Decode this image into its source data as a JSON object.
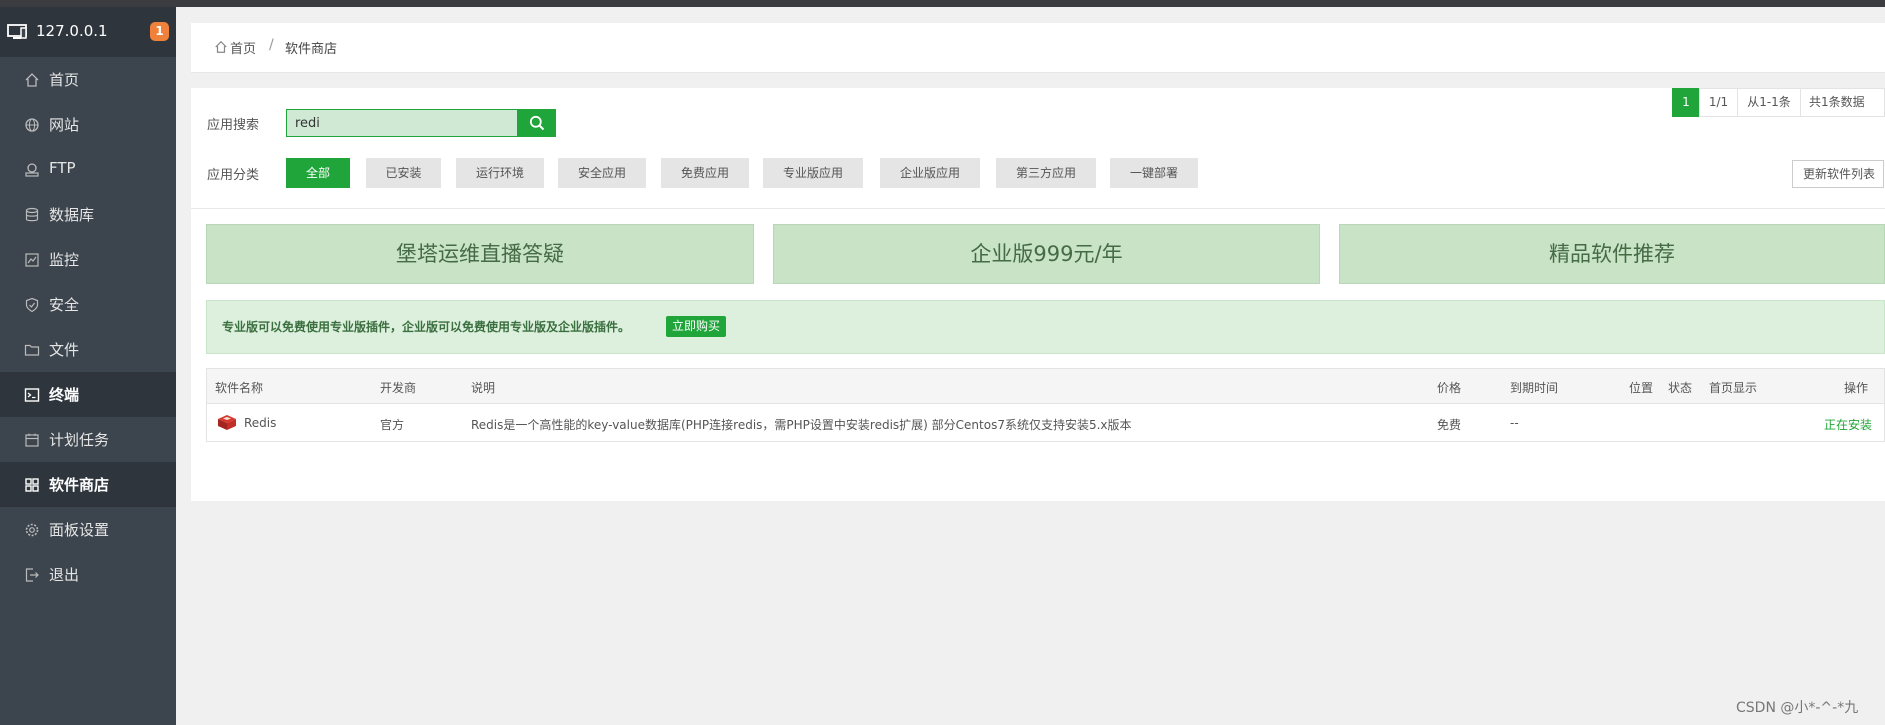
{
  "sidebar": {
    "host": "127.0.0.1",
    "badge": "1",
    "items": [
      {
        "label": "首页",
        "icon": "home-icon"
      },
      {
        "label": "网站",
        "icon": "globe-icon"
      },
      {
        "label": "FTP",
        "icon": "ftp-icon"
      },
      {
        "label": "数据库",
        "icon": "database-icon"
      },
      {
        "label": "监控",
        "icon": "monitor-chart-icon"
      },
      {
        "label": "安全",
        "icon": "shield-icon"
      },
      {
        "label": "文件",
        "icon": "folder-icon"
      },
      {
        "label": "终端",
        "icon": "terminal-icon"
      },
      {
        "label": "计划任务",
        "icon": "calendar-icon"
      },
      {
        "label": "软件商店",
        "icon": "grid-icon"
      },
      {
        "label": "面板设置",
        "icon": "gear-icon"
      },
      {
        "label": "退出",
        "icon": "logout-icon"
      }
    ]
  },
  "breadcrumb": {
    "home": "首页",
    "separator": "/",
    "current": "软件商店"
  },
  "search": {
    "label": "应用搜索",
    "value": "redi"
  },
  "categories": {
    "label": "应用分类",
    "items": [
      "全部",
      "已安装",
      "运行环境",
      "安全应用",
      "免费应用",
      "专业版应用",
      "企业版应用",
      "第三方应用",
      "一键部署"
    ],
    "selected": "全部"
  },
  "refresh_label": "更新软件列表",
  "banners": [
    "堡塔运维直播答疑",
    "企业版999元/年",
    "精品软件推荐"
  ],
  "notice": {
    "text": "专业版可以免费使用专业版插件，企业版可以免费使用专业版及企业版插件。",
    "button": "立即购买"
  },
  "table": {
    "headers": [
      "软件名称",
      "开发商",
      "说明",
      "价格",
      "到期时间",
      "位置",
      "状态",
      "首页显示",
      "操作"
    ],
    "rows": [
      {
        "name": "Redis",
        "developer": "官方",
        "description": "Redis是一个高性能的key-value数据库(PHP连接redis，需PHP设置中安装redis扩展) 部分Centos7系统仅支持安装5.x版本",
        "price": "免费",
        "expire": "--",
        "position": "",
        "status": "",
        "home_display": "",
        "action": "正在安装"
      }
    ]
  },
  "pagination": {
    "current": "1",
    "pages": "1/1",
    "range": "从1-1条",
    "total": "共1条数据"
  },
  "watermark": "CSDN @小*-^-*九",
  "colors": {
    "accent": "#20a53a",
    "sidebar": "#3c444d",
    "badge": "#f0813a"
  }
}
